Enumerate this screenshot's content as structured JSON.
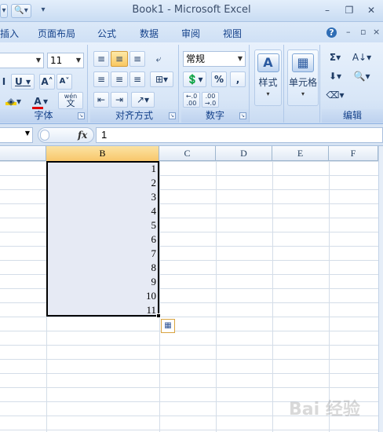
{
  "window": {
    "title": "Book1 - Microsoft Excel",
    "minimize": "–",
    "restore": "❐",
    "close": "✕"
  },
  "menu": {
    "tabs": [
      "插入",
      "页面布局",
      "公式",
      "数据",
      "审阅",
      "视图"
    ],
    "help": "?",
    "inner_min": "–",
    "inner_restore": "▫",
    "inner_close": "×"
  },
  "ribbon": {
    "font": {
      "label": "字体",
      "font_name": "",
      "font_size": "11",
      "underline": "U",
      "grow": "A",
      "shrink": "A",
      "font_color": "A",
      "phonetic": "wén",
      "phonetic_char": "文"
    },
    "alignment": {
      "label": "对齐方式"
    },
    "number": {
      "label": "数字",
      "format": "常规",
      "percent": "%",
      "comma": ",",
      "inc_decimal": "+.0 .00",
      "dec_decimal": ".00 →.0"
    },
    "styles": {
      "label": "样式"
    },
    "cells": {
      "label": "单元格"
    },
    "editing": {
      "label": "编辑",
      "sum": "Σ"
    }
  },
  "formula_bar": {
    "name_box": "",
    "fx": "fx",
    "value": "1"
  },
  "sheet": {
    "columns": [
      "B",
      "C",
      "D",
      "E",
      "F"
    ],
    "selected_column": "B",
    "values": [
      "1",
      "2",
      "3",
      "4",
      "5",
      "6",
      "7",
      "8",
      "9",
      "10",
      "11"
    ]
  },
  "watermark": "Bai 经验"
}
